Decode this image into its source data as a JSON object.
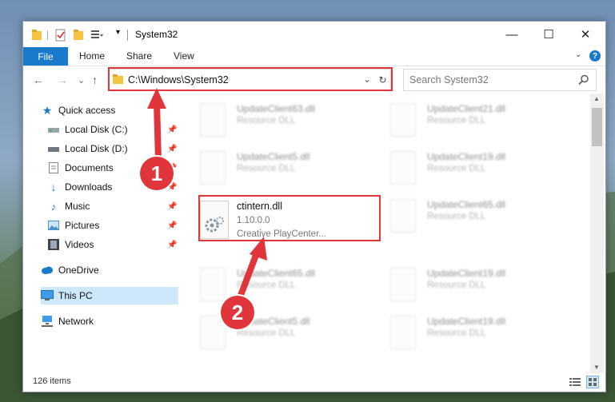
{
  "window": {
    "title": "System32",
    "controls": {
      "minimize": "—",
      "maximize": "☐",
      "close": "✕"
    }
  },
  "ribbon": {
    "file": "File",
    "tabs": [
      "Home",
      "Share",
      "View"
    ],
    "expand": "⌄",
    "help": "?"
  },
  "nav": {
    "back": "←",
    "forward": "→",
    "recent": "⌄",
    "up": "↑",
    "address": "C:\\Windows\\System32",
    "address_dropdown": "⌄",
    "refresh": "↻",
    "search_placeholder": "Search System32"
  },
  "sidebar": {
    "items": [
      {
        "label": "Quick access",
        "icon": "star-icon",
        "pinned": false
      },
      {
        "label": "Local Disk (C:)",
        "icon": "drive-icon",
        "pinned": true
      },
      {
        "label": "Local Disk (D:)",
        "icon": "drive-icon",
        "pinned": true
      },
      {
        "label": "Documents",
        "icon": "documents-icon",
        "pinned": true
      },
      {
        "label": "Downloads",
        "icon": "downloads-icon",
        "pinned": true
      },
      {
        "label": "Music",
        "icon": "music-icon",
        "pinned": true
      },
      {
        "label": "Pictures",
        "icon": "pictures-icon",
        "pinned": true
      },
      {
        "label": "Videos",
        "icon": "videos-icon",
        "pinned": true
      },
      {
        "label": "OneDrive",
        "icon": "cloud-icon",
        "pinned": false
      },
      {
        "label": "This PC",
        "icon": "computer-icon",
        "pinned": false,
        "selected": true
      },
      {
        "label": "Network",
        "icon": "network-icon",
        "pinned": false
      }
    ]
  },
  "files": {
    "left": [
      {
        "name": "UpdateClient63.dll",
        "sub": "Resource DLL"
      },
      {
        "name": "UpdateClient5.dll",
        "sub": "Resource DLL"
      },
      {
        "name": "ctintern.dll",
        "version": "1.10.0.0",
        "company": "Creative PlayCenter..."
      },
      {
        "name": "UpdateClient65.dll",
        "sub": "Resource DLL"
      },
      {
        "name": "UpdateClient5.dll",
        "sub": "Resource DLL"
      }
    ],
    "right": [
      {
        "name": "UpdateClient21.dll",
        "sub": "Resource DLL"
      },
      {
        "name": "UpdateClient19.dll",
        "sub": "Resource DLL"
      },
      {
        "name": "UpdateClient65.dll",
        "sub": "Resource DLL"
      },
      {
        "name": "UpdateClient19.dll",
        "sub": "Resource DLL"
      },
      {
        "name": "UpdateClient19.dll",
        "sub": "Resource DLL"
      }
    ]
  },
  "status": {
    "count": "126 items"
  },
  "annotations": {
    "step1": "1",
    "step2": "2"
  },
  "colors": {
    "accent": "#1979ca",
    "highlight": "#e0353a",
    "selected": "#cde8fb"
  }
}
